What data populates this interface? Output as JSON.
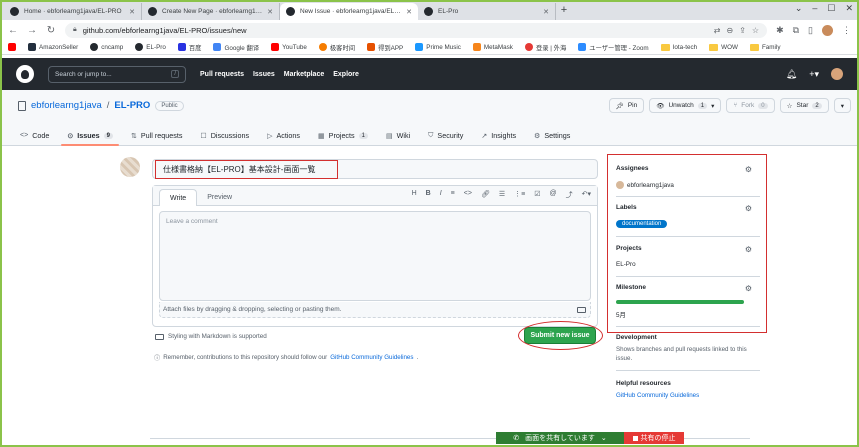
{
  "browser": {
    "tabs": [
      {
        "title": "Home · ebforlearng1java/EL-PRO",
        "active": false
      },
      {
        "title": "Create New Page · ebforlearng1java",
        "active": false
      },
      {
        "title": "New Issue · ebforlearng1java/EL-PRO",
        "active": true
      },
      {
        "title": "EL-Pro",
        "active": false
      }
    ],
    "url": "github.com/ebforlearng1java/EL-PRO/issues/new",
    "bookmarks": [
      "AmazonSeller",
      "cncamp",
      "EL-Pro",
      "百度",
      "Google 翻译",
      "YouTube",
      "极客时间",
      "得到APP",
      "Prime Music",
      "MetaMask",
      "登录 | 外海",
      "ユーザー管理 - Zoom",
      "Iota-tech",
      "WOW",
      "Family"
    ]
  },
  "gh": {
    "search_placeholder": "Search or jump to...",
    "search_key": "/",
    "nav": [
      "Pull requests",
      "Issues",
      "Marketplace",
      "Explore"
    ]
  },
  "repo": {
    "owner": "ebforlearng1java",
    "sep": "/",
    "name": "EL-PRO",
    "visibility": "Public",
    "pin": "Pin",
    "unwatch": "Unwatch",
    "watch_count": "1",
    "fork": "Fork",
    "fork_count": "0",
    "star": "Star",
    "star_count": "2",
    "tabs": [
      {
        "label": "Code",
        "icon": "<>",
        "count": ""
      },
      {
        "label": "Issues",
        "icon": "⊙",
        "count": "9"
      },
      {
        "label": "Pull requests",
        "icon": "⇅",
        "count": ""
      },
      {
        "label": "Discussions",
        "icon": "☐",
        "count": ""
      },
      {
        "label": "Actions",
        "icon": "▷",
        "count": ""
      },
      {
        "label": "Projects",
        "icon": "▦",
        "count": "1"
      },
      {
        "label": "Wiki",
        "icon": "▤",
        "count": ""
      },
      {
        "label": "Security",
        "icon": "⛉",
        "count": ""
      },
      {
        "label": "Insights",
        "icon": "↗",
        "count": ""
      },
      {
        "label": "Settings",
        "icon": "⚙",
        "count": ""
      }
    ]
  },
  "issue": {
    "title_value": "仕様書格納【EL-PRO】基本設計-画面一覧",
    "tab_write": "Write",
    "tab_preview": "Preview",
    "comment_placeholder": "Leave a comment",
    "attach_text": "Attach files by dragging & dropping, selecting or pasting them.",
    "markdown_note": "Styling with Markdown is supported",
    "submit": "Submit new issue",
    "remember": "Remember, contributions to this repository should follow our",
    "guidelines_link": "GitHub Community Guidelines",
    "remember_end": "."
  },
  "sidebar": {
    "assignees_label": "Assignees",
    "assignee": "ebforlearng1java",
    "labels_label": "Labels",
    "label": "documentation",
    "label_color": "#0075ca",
    "projects_label": "Projects",
    "project": "EL-Pro",
    "milestone_label": "Milestone",
    "milestone_progress": 1.0,
    "milestone": "5月",
    "development_label": "Development",
    "development_text": "Shows branches and pull requests linked to this issue.",
    "helpful_label": "Helpful resources",
    "helpful_link": "GitHub Community Guidelines"
  },
  "share": {
    "sharing": "画面を共有しています",
    "stop": "共有の停止"
  }
}
